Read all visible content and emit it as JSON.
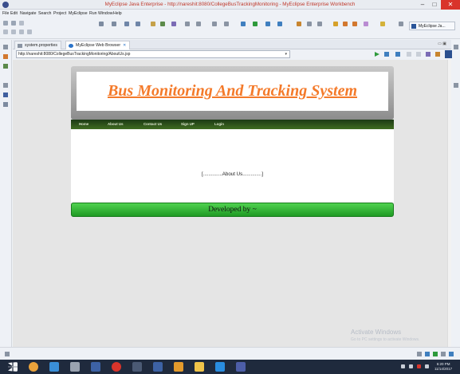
{
  "window": {
    "title": "MyEclipse Java Enterprise - http://nareshit:8080/CollegeBusTrackingMonitoring - MyEclipse Enterprise Workbench"
  },
  "menu": [
    "File",
    "Edit",
    "Navigate",
    "Search",
    "Project",
    "MyEclipse",
    "Run",
    "Window",
    "Help"
  ],
  "perspective": {
    "label": "MyEclipse Ja..."
  },
  "editor_tabs": [
    {
      "label": "system.properties",
      "active": false
    },
    {
      "label": "MyEclipse Web Browser",
      "active": true
    }
  ],
  "browser": {
    "url": "http://nareshit:8080/CollegeBusTrackingMonitoring/AboutUs.jsp"
  },
  "page": {
    "site_title": "Bus Monitoring And Tracking System",
    "nav": [
      "Home",
      "About Us",
      "Contact Us",
      "Sign UP",
      "Login"
    ],
    "content": "[..............About Us..............]",
    "footer": "Developed by ~"
  },
  "watermark": {
    "line1": "Activate Windows",
    "line2": "Go to PC settings to activate Windows."
  },
  "clock": {
    "time": "6:20 PM",
    "date": "11/14/2017"
  },
  "colors": {
    "title_orange": "#f47a2a",
    "nav_green": "#2d5219",
    "footer_green": "#36b83a",
    "close_red": "#d9342b"
  }
}
